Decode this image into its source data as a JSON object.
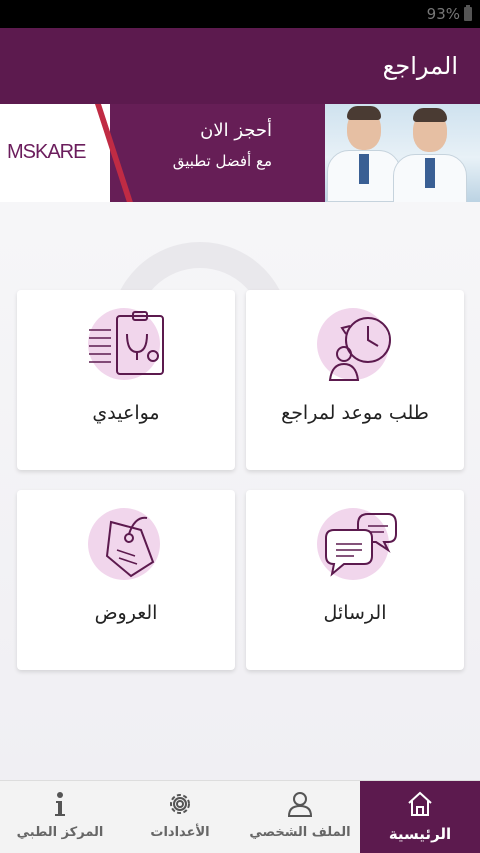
{
  "status_bar": {
    "battery": "93%"
  },
  "app_bar": {
    "title": "المراجع"
  },
  "banner": {
    "headline": "أحجز الان",
    "subline": "مع أفضل تطبيق",
    "logo": "MSKARE"
  },
  "tiles": [
    {
      "label": "طلب موعد لمراجع",
      "icon": "clock-patient-icon"
    },
    {
      "label": "مواعيدي",
      "icon": "clipboard-stethoscope-icon"
    },
    {
      "label": "الرسائل",
      "icon": "chat-bubbles-icon"
    },
    {
      "label": "العروض",
      "icon": "price-tag-icon"
    }
  ],
  "bottom_nav": {
    "items": [
      {
        "label": "الرئيسية",
        "icon": "home-icon",
        "active": true
      },
      {
        "label": "الملف الشخصي",
        "icon": "user-icon",
        "active": false
      },
      {
        "label": "الأعدادات",
        "icon": "gear-icon",
        "active": false
      },
      {
        "label": "المركز الطبي",
        "icon": "info-icon",
        "active": false
      }
    ]
  },
  "colors": {
    "primary": "#5c1a4e",
    "accent_light": "#f1d6ec",
    "icon_stroke": "#5c1a4e",
    "logo_red": "#c02b44"
  }
}
